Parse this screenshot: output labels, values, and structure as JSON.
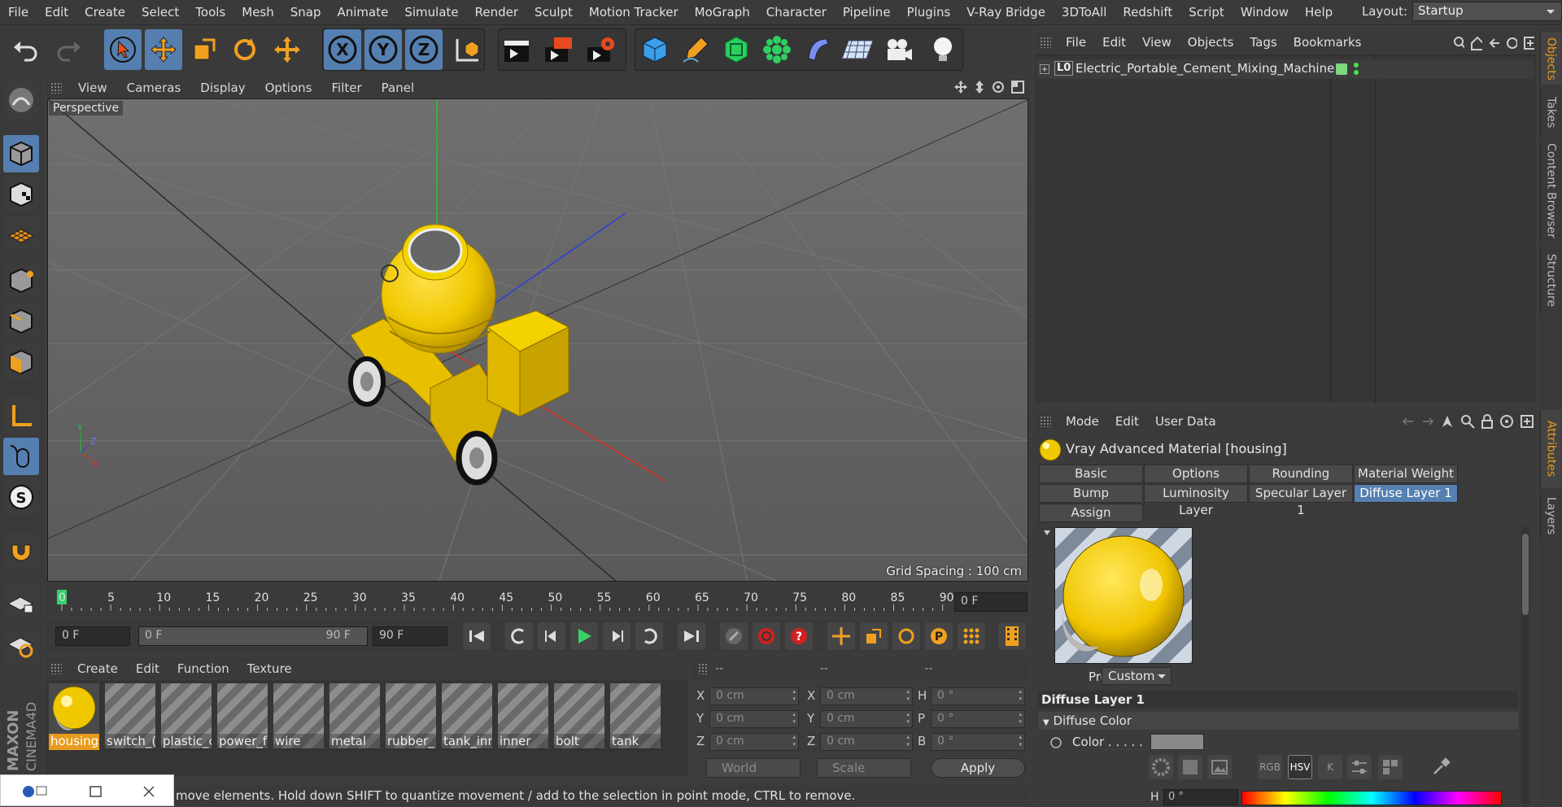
{
  "menubar": {
    "items": [
      "File",
      "Edit",
      "Create",
      "Select",
      "Tools",
      "Mesh",
      "Snap",
      "Animate",
      "Simulate",
      "Render",
      "Sculpt",
      "Motion Tracker",
      "MoGraph",
      "Character",
      "Pipeline",
      "Plugins",
      "V-Ray Bridge",
      "3DToAll",
      "Redshift",
      "Script",
      "Window",
      "Help"
    ],
    "layout_label": "Layout:",
    "layout_value": "Startup"
  },
  "toolbar": {
    "axis_x": "X",
    "axis_y": "Y",
    "axis_z": "Z"
  },
  "viewport": {
    "menu": [
      "View",
      "Cameras",
      "Display",
      "Options",
      "Filter",
      "Panel"
    ],
    "view_label": "Perspective",
    "grid_spacing": "Grid Spacing : 100 cm",
    "axis_y": "Y",
    "axis_z": "Z",
    "axis_x": "X"
  },
  "timeline": {
    "ticks": [
      "0",
      "5",
      "10",
      "15",
      "20",
      "25",
      "30",
      "35",
      "40",
      "45",
      "50",
      "55",
      "60",
      "65",
      "70",
      "75",
      "80",
      "85",
      "90"
    ],
    "current_frame_field": "0 F",
    "start_field": "0 F",
    "range_left": "0 F",
    "range_right": "90 F",
    "end_field": "90 F"
  },
  "material_manager": {
    "menu": [
      "Create",
      "Edit",
      "Function",
      "Texture"
    ],
    "materials": [
      {
        "name": "housing",
        "selected": true
      },
      {
        "name": "switch_(",
        "selected": false
      },
      {
        "name": "plastic_c",
        "selected": false
      },
      {
        "name": "power_f",
        "selected": false
      },
      {
        "name": "wire",
        "selected": false
      },
      {
        "name": "metal",
        "selected": false
      },
      {
        "name": "rubber_",
        "selected": false
      },
      {
        "name": "tank_inr",
        "selected": false
      },
      {
        "name": "inner",
        "selected": false
      },
      {
        "name": "bolt",
        "selected": false
      },
      {
        "name": "tank",
        "selected": false
      }
    ]
  },
  "coordinates": {
    "headers": [
      "--",
      "--",
      "--"
    ],
    "rows": [
      {
        "l1": "X",
        "v1": "0 cm",
        "l2": "X",
        "v2": "0 cm",
        "l3": "H",
        "v3": "0 °"
      },
      {
        "l1": "Y",
        "v1": "0 cm",
        "l2": "Y",
        "v2": "0 cm",
        "l3": "P",
        "v3": "0 °"
      },
      {
        "l1": "Z",
        "v1": "0 cm",
        "l2": "Z",
        "v2": "0 cm",
        "l3": "B",
        "v3": "0 °"
      }
    ],
    "mode_dropdown": "World",
    "scale_dropdown": "Scale",
    "apply": "Apply"
  },
  "status_bar": "move elements. Hold down SHIFT to quantize movement / add to the selection in point mode, CTRL to remove.",
  "objects_panel": {
    "menu": [
      "File",
      "Edit",
      "View",
      "Objects",
      "Tags",
      "Bookmarks"
    ],
    "object_name": "Electric_Portable_Cement_Mixing_Machine",
    "layer_marker": "L0"
  },
  "side_tabs": [
    "Objects",
    "Takes",
    "Content Browser",
    "Structure",
    "Attributes",
    "Layers"
  ],
  "attributes": {
    "menu": [
      "Mode",
      "Edit",
      "User Data"
    ],
    "title": "Vray Advanced Material [housing]",
    "tabs_row1": [
      "Basic",
      "Options",
      "Rounding",
      "Material Weight"
    ],
    "tabs_row2": [
      "Bump",
      "Luminosity Layer",
      "Specular Layer 1",
      "Diffuse Layer 1"
    ],
    "tabs_row3": [
      "Assign"
    ],
    "active_tab": "Diffuse Layer 1",
    "preset_label": "Preset",
    "preset_value": "Custom",
    "section_title": "Diffuse Layer 1",
    "subsection": "Diffuse Color",
    "color_label": "Color . . . . .",
    "mini_buttons": [
      "RGB",
      "HSV",
      "K"
    ],
    "h_label": "H",
    "h_value": "0 °"
  },
  "colors": {
    "accent_blue": "#557fb0",
    "selection_orange": "#e89c1c",
    "model_yellow": "#f0c800"
  }
}
